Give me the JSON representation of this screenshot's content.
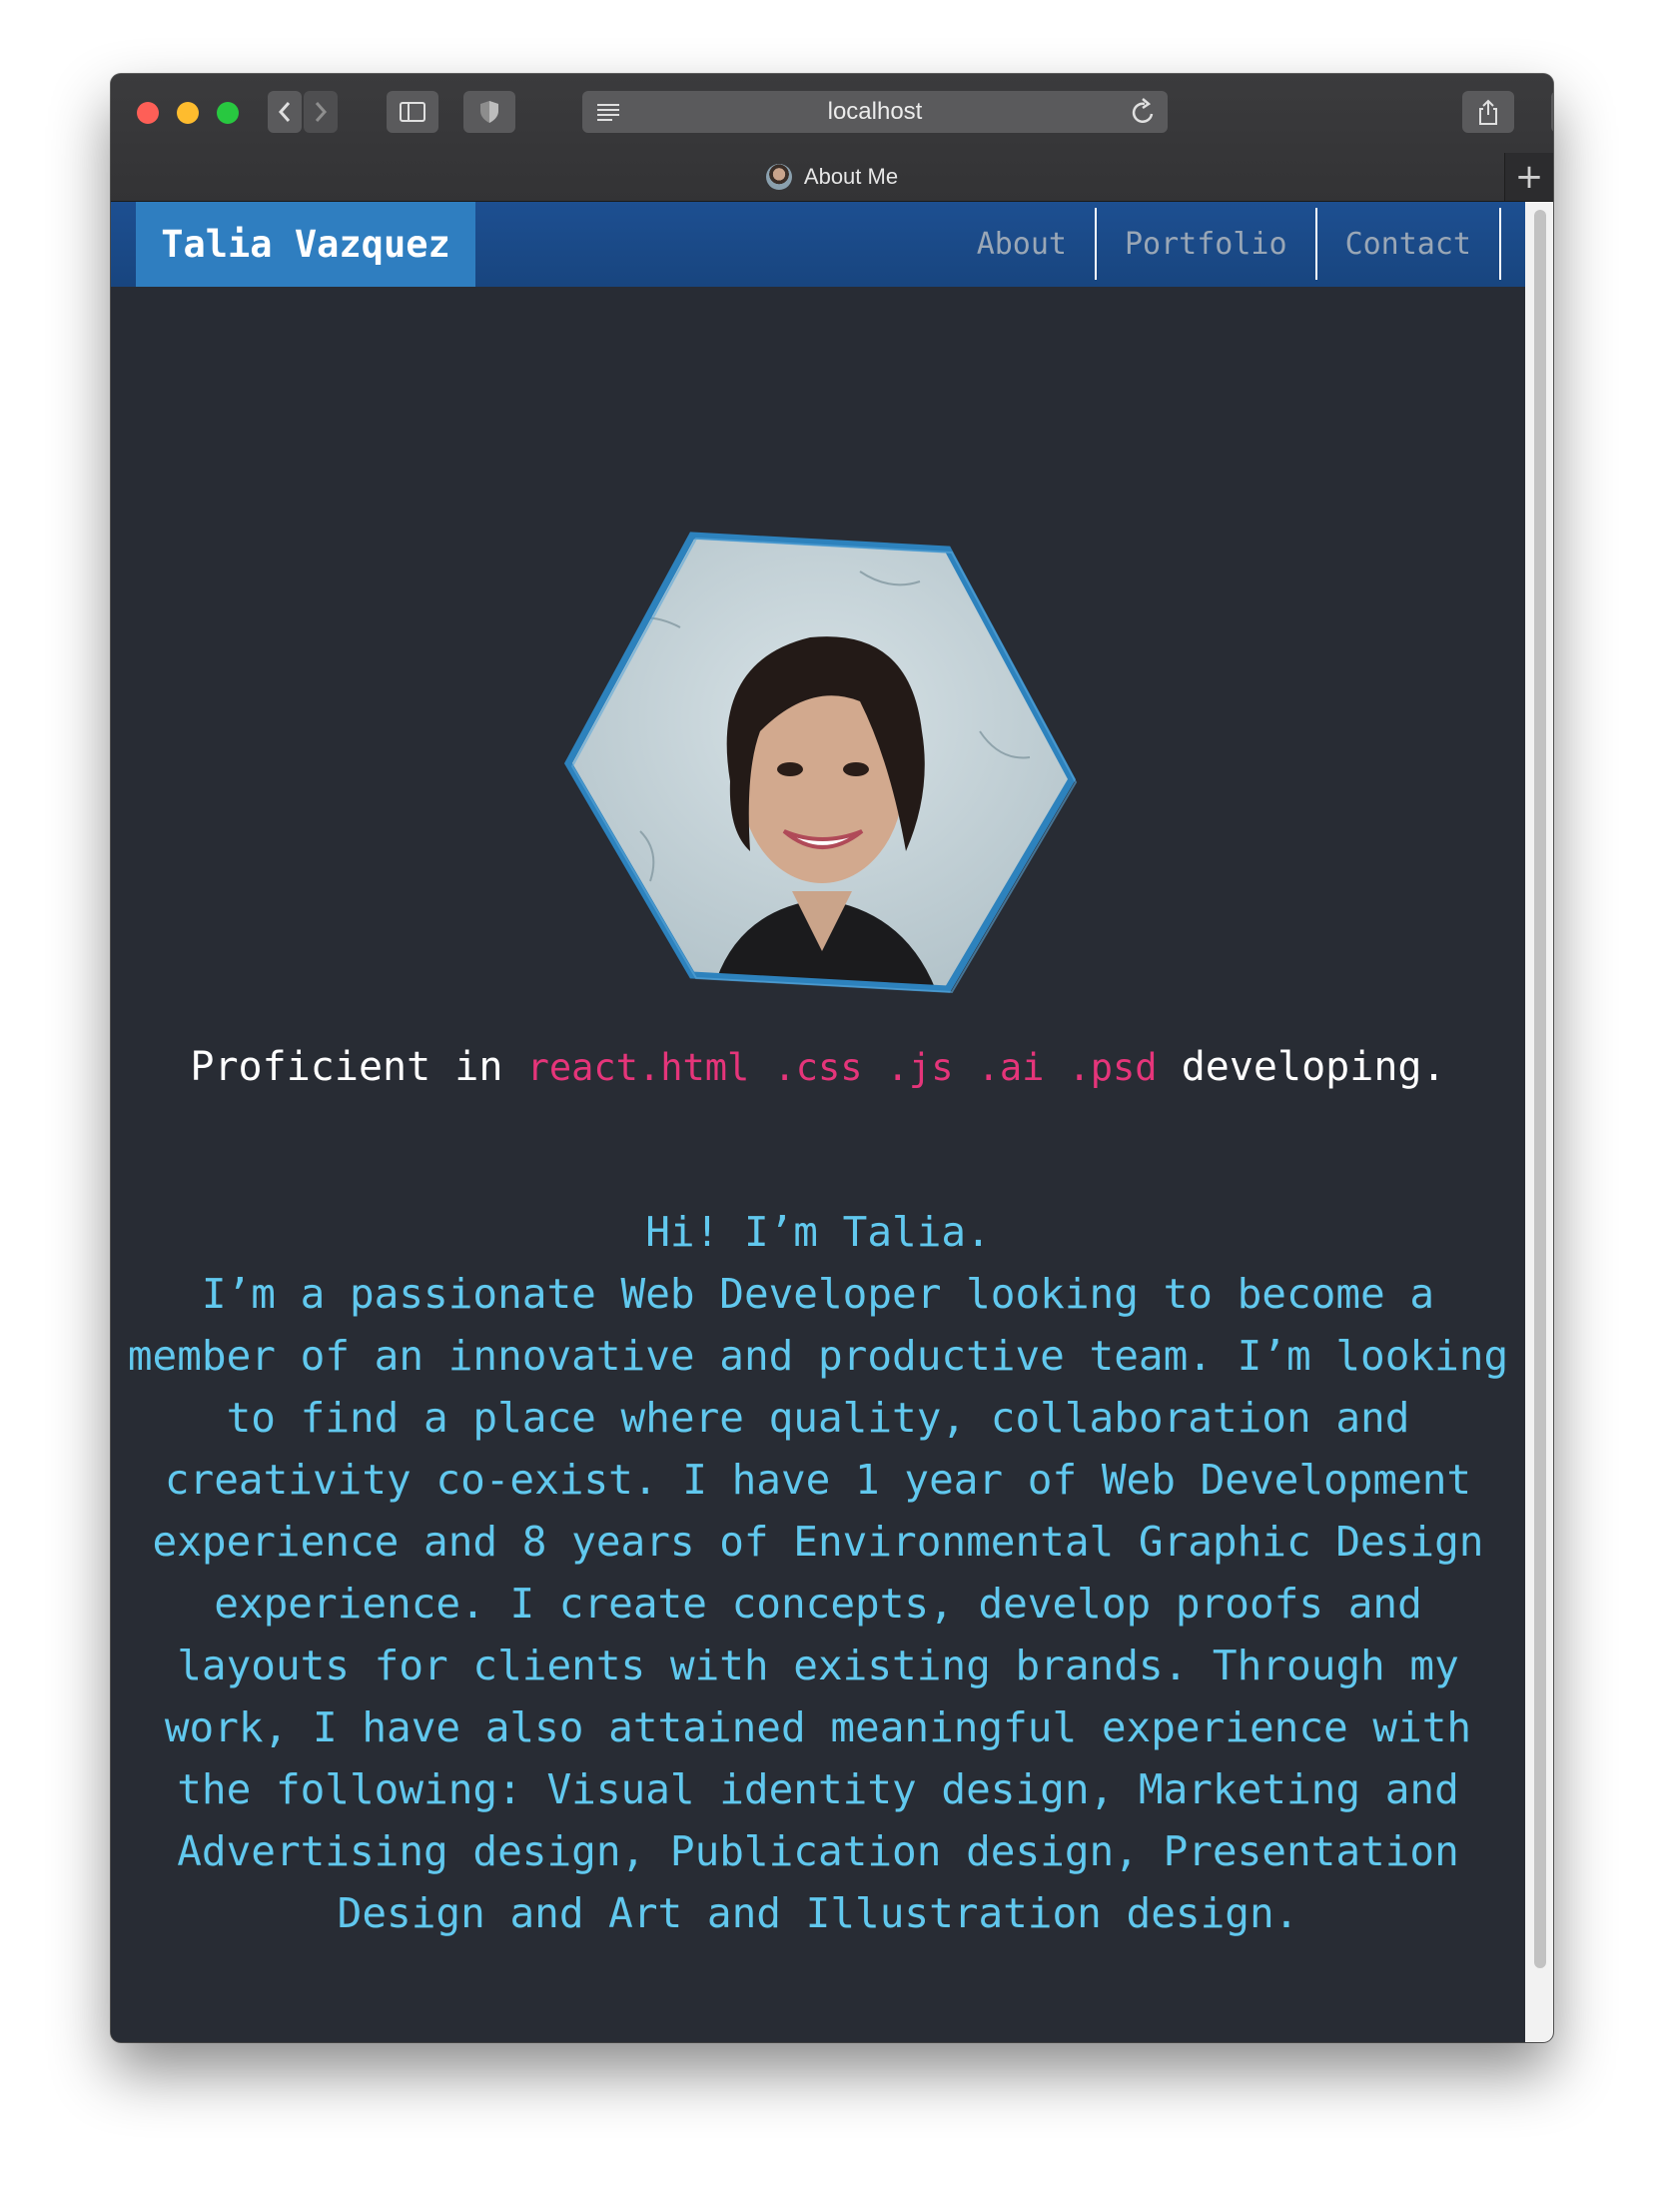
{
  "browser": {
    "url": "localhost",
    "tab_title": "About Me",
    "new_tab": "+"
  },
  "navbar": {
    "brand": "Talia Vazquez",
    "links": [
      "About",
      "Portfolio",
      "Contact"
    ]
  },
  "hero": {
    "proficient_prefix": "Proficient in",
    "technologies": [
      "react",
      ".html",
      ".css",
      ".js",
      ".ai",
      ".psd"
    ],
    "proficient_suffix": "developing."
  },
  "intro": {
    "greeting": "Hi! I’m Talia.",
    "lines": [
      "I’m a passionate Web Developer looking to become a",
      "member of an innovative and productive team. I’m looking",
      "to find a place where quality, collaboration and",
      "creativity co-exist. I have 1 year of Web Development",
      "experience and 8 years of Environmental Graphic Design",
      "experience. I create concepts, develop proofs and",
      "layouts for clients with existing brands. Through my",
      "work, I have also attained meaningful experience with",
      "the following: Visual identity design, Marketing and",
      "Advertising design, Publication design, Presentation",
      "Design and Art and Illustration design."
    ]
  },
  "colors": {
    "page_background": "#282c34",
    "navbar": "#1d4f91",
    "brand_block": "#2f7ec0",
    "tech_accent": "#e5357a",
    "intro_text": "#61c8ee"
  }
}
